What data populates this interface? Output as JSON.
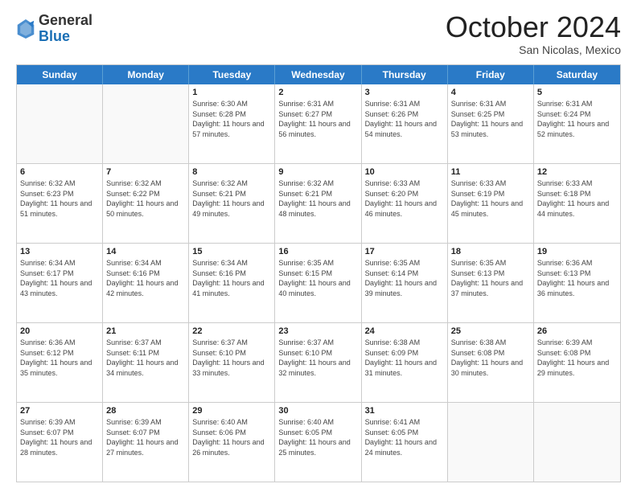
{
  "header": {
    "logo_general": "General",
    "logo_blue": "Blue",
    "month_title": "October 2024",
    "location": "San Nicolas, Mexico"
  },
  "days_of_week": [
    "Sunday",
    "Monday",
    "Tuesday",
    "Wednesday",
    "Thursday",
    "Friday",
    "Saturday"
  ],
  "weeks": [
    [
      {
        "day": "",
        "sunrise": "",
        "sunset": "",
        "daylight": ""
      },
      {
        "day": "",
        "sunrise": "",
        "sunset": "",
        "daylight": ""
      },
      {
        "day": "1",
        "sunrise": "Sunrise: 6:30 AM",
        "sunset": "Sunset: 6:28 PM",
        "daylight": "Daylight: 11 hours and 57 minutes."
      },
      {
        "day": "2",
        "sunrise": "Sunrise: 6:31 AM",
        "sunset": "Sunset: 6:27 PM",
        "daylight": "Daylight: 11 hours and 56 minutes."
      },
      {
        "day": "3",
        "sunrise": "Sunrise: 6:31 AM",
        "sunset": "Sunset: 6:26 PM",
        "daylight": "Daylight: 11 hours and 54 minutes."
      },
      {
        "day": "4",
        "sunrise": "Sunrise: 6:31 AM",
        "sunset": "Sunset: 6:25 PM",
        "daylight": "Daylight: 11 hours and 53 minutes."
      },
      {
        "day": "5",
        "sunrise": "Sunrise: 6:31 AM",
        "sunset": "Sunset: 6:24 PM",
        "daylight": "Daylight: 11 hours and 52 minutes."
      }
    ],
    [
      {
        "day": "6",
        "sunrise": "Sunrise: 6:32 AM",
        "sunset": "Sunset: 6:23 PM",
        "daylight": "Daylight: 11 hours and 51 minutes."
      },
      {
        "day": "7",
        "sunrise": "Sunrise: 6:32 AM",
        "sunset": "Sunset: 6:22 PM",
        "daylight": "Daylight: 11 hours and 50 minutes."
      },
      {
        "day": "8",
        "sunrise": "Sunrise: 6:32 AM",
        "sunset": "Sunset: 6:21 PM",
        "daylight": "Daylight: 11 hours and 49 minutes."
      },
      {
        "day": "9",
        "sunrise": "Sunrise: 6:32 AM",
        "sunset": "Sunset: 6:21 PM",
        "daylight": "Daylight: 11 hours and 48 minutes."
      },
      {
        "day": "10",
        "sunrise": "Sunrise: 6:33 AM",
        "sunset": "Sunset: 6:20 PM",
        "daylight": "Daylight: 11 hours and 46 minutes."
      },
      {
        "day": "11",
        "sunrise": "Sunrise: 6:33 AM",
        "sunset": "Sunset: 6:19 PM",
        "daylight": "Daylight: 11 hours and 45 minutes."
      },
      {
        "day": "12",
        "sunrise": "Sunrise: 6:33 AM",
        "sunset": "Sunset: 6:18 PM",
        "daylight": "Daylight: 11 hours and 44 minutes."
      }
    ],
    [
      {
        "day": "13",
        "sunrise": "Sunrise: 6:34 AM",
        "sunset": "Sunset: 6:17 PM",
        "daylight": "Daylight: 11 hours and 43 minutes."
      },
      {
        "day": "14",
        "sunrise": "Sunrise: 6:34 AM",
        "sunset": "Sunset: 6:16 PM",
        "daylight": "Daylight: 11 hours and 42 minutes."
      },
      {
        "day": "15",
        "sunrise": "Sunrise: 6:34 AM",
        "sunset": "Sunset: 6:16 PM",
        "daylight": "Daylight: 11 hours and 41 minutes."
      },
      {
        "day": "16",
        "sunrise": "Sunrise: 6:35 AM",
        "sunset": "Sunset: 6:15 PM",
        "daylight": "Daylight: 11 hours and 40 minutes."
      },
      {
        "day": "17",
        "sunrise": "Sunrise: 6:35 AM",
        "sunset": "Sunset: 6:14 PM",
        "daylight": "Daylight: 11 hours and 39 minutes."
      },
      {
        "day": "18",
        "sunrise": "Sunrise: 6:35 AM",
        "sunset": "Sunset: 6:13 PM",
        "daylight": "Daylight: 11 hours and 37 minutes."
      },
      {
        "day": "19",
        "sunrise": "Sunrise: 6:36 AM",
        "sunset": "Sunset: 6:13 PM",
        "daylight": "Daylight: 11 hours and 36 minutes."
      }
    ],
    [
      {
        "day": "20",
        "sunrise": "Sunrise: 6:36 AM",
        "sunset": "Sunset: 6:12 PM",
        "daylight": "Daylight: 11 hours and 35 minutes."
      },
      {
        "day": "21",
        "sunrise": "Sunrise: 6:37 AM",
        "sunset": "Sunset: 6:11 PM",
        "daylight": "Daylight: 11 hours and 34 minutes."
      },
      {
        "day": "22",
        "sunrise": "Sunrise: 6:37 AM",
        "sunset": "Sunset: 6:10 PM",
        "daylight": "Daylight: 11 hours and 33 minutes."
      },
      {
        "day": "23",
        "sunrise": "Sunrise: 6:37 AM",
        "sunset": "Sunset: 6:10 PM",
        "daylight": "Daylight: 11 hours and 32 minutes."
      },
      {
        "day": "24",
        "sunrise": "Sunrise: 6:38 AM",
        "sunset": "Sunset: 6:09 PM",
        "daylight": "Daylight: 11 hours and 31 minutes."
      },
      {
        "day": "25",
        "sunrise": "Sunrise: 6:38 AM",
        "sunset": "Sunset: 6:08 PM",
        "daylight": "Daylight: 11 hours and 30 minutes."
      },
      {
        "day": "26",
        "sunrise": "Sunrise: 6:39 AM",
        "sunset": "Sunset: 6:08 PM",
        "daylight": "Daylight: 11 hours and 29 minutes."
      }
    ],
    [
      {
        "day": "27",
        "sunrise": "Sunrise: 6:39 AM",
        "sunset": "Sunset: 6:07 PM",
        "daylight": "Daylight: 11 hours and 28 minutes."
      },
      {
        "day": "28",
        "sunrise": "Sunrise: 6:39 AM",
        "sunset": "Sunset: 6:07 PM",
        "daylight": "Daylight: 11 hours and 27 minutes."
      },
      {
        "day": "29",
        "sunrise": "Sunrise: 6:40 AM",
        "sunset": "Sunset: 6:06 PM",
        "daylight": "Daylight: 11 hours and 26 minutes."
      },
      {
        "day": "30",
        "sunrise": "Sunrise: 6:40 AM",
        "sunset": "Sunset: 6:05 PM",
        "daylight": "Daylight: 11 hours and 25 minutes."
      },
      {
        "day": "31",
        "sunrise": "Sunrise: 6:41 AM",
        "sunset": "Sunset: 6:05 PM",
        "daylight": "Daylight: 11 hours and 24 minutes."
      },
      {
        "day": "",
        "sunrise": "",
        "sunset": "",
        "daylight": ""
      },
      {
        "day": "",
        "sunrise": "",
        "sunset": "",
        "daylight": ""
      }
    ]
  ]
}
